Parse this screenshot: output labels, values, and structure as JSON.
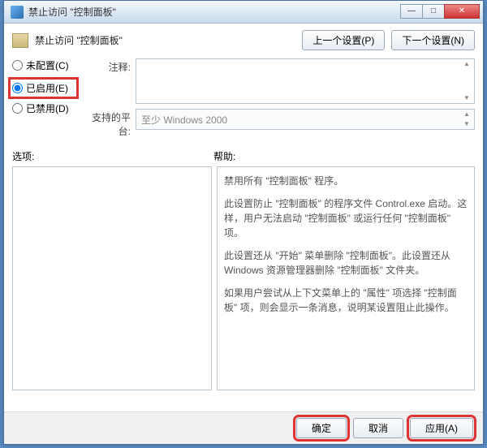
{
  "titlebar": {
    "text": "禁止访问 \"控制面板\""
  },
  "header": {
    "title": "禁止访问 \"控制面板\"",
    "prev": "上一个设置(P)",
    "next": "下一个设置(N)"
  },
  "radios": {
    "not_configured": "未配置(C)",
    "enabled": "已启用(E)",
    "disabled": "已禁用(D)"
  },
  "fields": {
    "comment_label": "注释:",
    "platform_label": "支持的平台:",
    "platform_value": "至少 Windows 2000"
  },
  "panels": {
    "options_label": "选项:",
    "help_label": "帮助:"
  },
  "help": {
    "p1": "禁用所有 \"控制面板\" 程序。",
    "p2": "此设置防止 \"控制面板\" 的程序文件 Control.exe 启动。这样，用户无法启动 \"控制面板\" 或运行任何 \"控制面板\" 项。",
    "p3": "此设置还从 \"开始\" 菜单删除 \"控制面板\"。此设置还从 Windows 资源管理器删除 \"控制面板\" 文件夹。",
    "p4": "如果用户尝试从上下文菜单上的 \"属性\" 项选择 \"控制面板\" 项，则会显示一条消息，说明某设置阻止此操作。"
  },
  "footer": {
    "ok": "确定",
    "cancel": "取消",
    "apply": "应用(A)"
  }
}
